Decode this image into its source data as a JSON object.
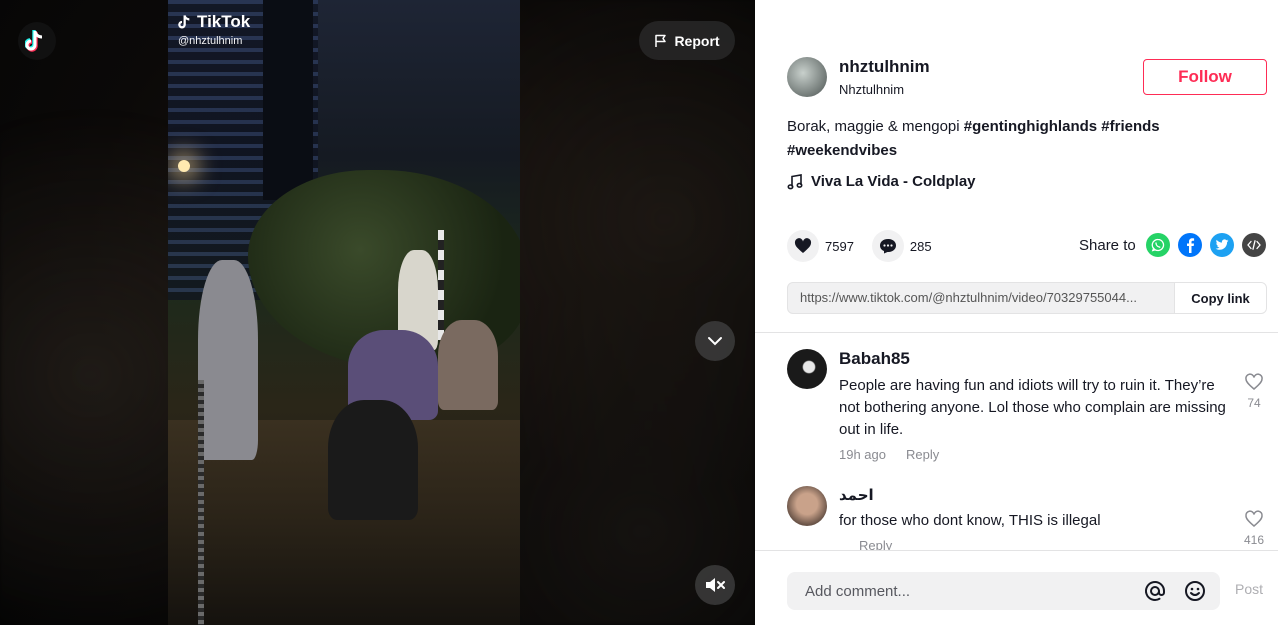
{
  "video": {
    "watermark_brand": "TikTok",
    "watermark_handle": "@nhztulhnim",
    "report_label": "Report"
  },
  "author": {
    "username": "nhztulhnim",
    "nickname": "Nhztulhnim",
    "follow_label": "Follow"
  },
  "description": {
    "text": "Borak, maggie & mengopi",
    "hashtags": [
      "#gentinghighlands",
      "#friends",
      "#weekendvibes"
    ]
  },
  "music": "Viva La Vida - Coldplay",
  "stats": {
    "likes": "7597",
    "comments": "285"
  },
  "share": {
    "label": "Share to",
    "icons": [
      "whatsapp-icon",
      "facebook-icon",
      "twitter-icon",
      "embed-icon"
    ],
    "colors": {
      "whatsapp": "#25d366",
      "facebook": "#0075fa",
      "twitter": "#1da1f2",
      "embed": "#444444"
    }
  },
  "link": {
    "url": "https://www.tiktok.com/@nhztulhnim/video/70329755044...",
    "copy_label": "Copy link"
  },
  "comments": [
    {
      "user": "Babah85",
      "text": "People are having fun and idiots will try to ruin it. They’re not bothering anyone. Lol those who complain are missing out in life.",
      "time": "19h ago",
      "reply_label": "Reply",
      "likes": "74"
    },
    {
      "user": "احمد",
      "text": "for those who dont know, THIS is illegal",
      "time": "",
      "reply_label": "Reply",
      "likes": "416"
    }
  ],
  "composer": {
    "placeholder": "Add comment...",
    "post_label": "Post"
  },
  "colors": {
    "accent": "#fe2c55",
    "text": "#161823",
    "muted": "#8a8b91"
  }
}
